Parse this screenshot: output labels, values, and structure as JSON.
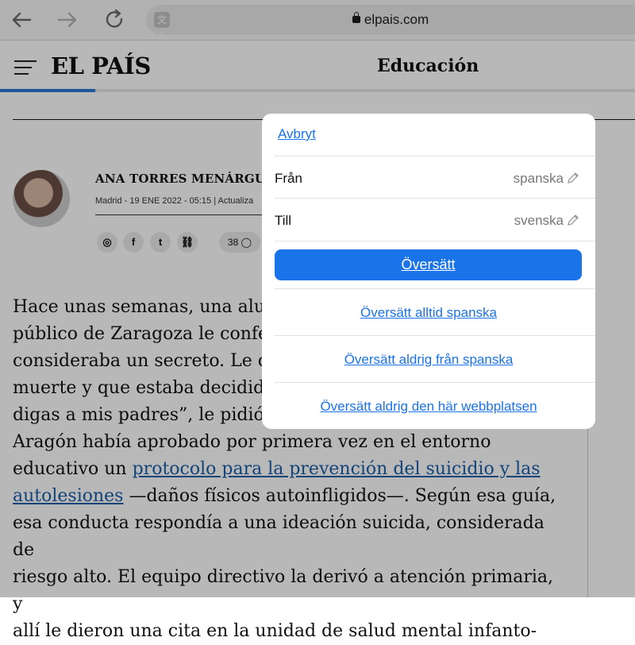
{
  "browser": {
    "url": "elpais.com",
    "translate_glyph": "文A"
  },
  "site": {
    "logo": "EL PAÍS",
    "section": "Educación",
    "reading_progress_percent": 15
  },
  "byline": {
    "author": "ANA TORRES MENÁRGUEZ",
    "meta": "Madrid - 19 ENE 2022 - 05:15 | Actualiza",
    "share_icons": [
      "whatsapp-icon",
      "facebook-icon",
      "twitter-icon",
      "link-icon"
    ],
    "share_glyphs": [
      "◎",
      "f",
      "t",
      "⛓"
    ],
    "comments_count": "38"
  },
  "article": {
    "lines": [
      "Hace unas semanas, una alum",
      "público de Zaragoza le confes",
      "consideraba un secreto. Le co",
      "muerte y que estaba decidida",
      "digas a mis padres”, le pidió. U",
      "Aragón había aprobado por primera vez en el entorno"
    ],
    "line7_prefix": "educativo un ",
    "link_part1": "protocolo para la prevención del suicidio y las",
    "link_part2": "autolesiones",
    "line8_suffix": " —daños físicos autoinfligidos—. Según esa guía,",
    "lines_after": [
      "esa conducta respondía a una ideación suicida, considerada de",
      "riesgo alto. El equipo directivo la derivó a atención primaria, y",
      "allí le dieron una cita en la unidad de salud mental infanto-"
    ]
  },
  "translate_sheet": {
    "cancel": "Avbryt",
    "from_label": "Från",
    "from_value": "spanska",
    "to_label": "Till",
    "to_value": "svenska",
    "translate_button": "Översätt",
    "always_translate": "Översätt alltid spanska",
    "never_translate_language": "Översätt aldrig från spanska",
    "never_translate_site": "Översätt aldrig den här webbplatsen",
    "accent_color": "#1a73e8"
  }
}
